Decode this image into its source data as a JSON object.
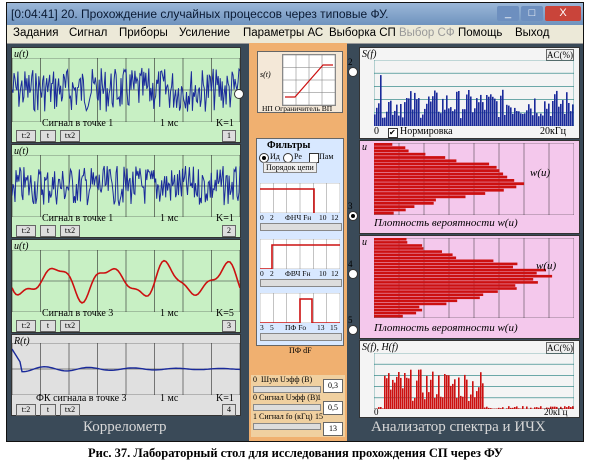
{
  "window": {
    "title": "[0:04:41] 20. Прохождение случайных процессов через типовые ФУ.",
    "buttons": {
      "minimize": "_",
      "maximize": "□",
      "close": "X"
    }
  },
  "menu": [
    "Задания",
    "Сигнал",
    "Приборы",
    "Усиление",
    "Параметры АС",
    "Выборка СП",
    "Выбор СФ",
    "Помощь",
    "Выход"
  ],
  "left": {
    "panels": [
      {
        "ylabel": "u(t)",
        "caption": "Сигнал в точке 1",
        "time": "1 мс",
        "k": "K=1",
        "num": "1"
      },
      {
        "ylabel": "u(t)",
        "caption": "Сигнал в точке 1",
        "time": "1 мс",
        "k": "K=1",
        "num": "2"
      },
      {
        "ylabel": "u(t)",
        "caption": "Сигнал в точке 3",
        "time": "1 мс",
        "k": "K=5",
        "num": "3"
      },
      {
        "ylabel": "R(t)",
        "caption": "ФК сигнала в точке 3",
        "time": "1 мс",
        "k": "K=1",
        "num": "4"
      }
    ],
    "buttons": [
      "t:2",
      "t",
      "tx2"
    ],
    "footer": "Коррелометр"
  },
  "middle": {
    "limiter": {
      "label": "НП Ограничитель ВП",
      "axis": "s(t)",
      "num": "2"
    },
    "filters": {
      "title": "Фильтры",
      "opt1": "Ид",
      "opt2": "Ре",
      "check": "Пам",
      "order": "Порядок цепи"
    },
    "f1": {
      "label": "ФНЧ Fн",
      "ticks": [
        "0",
        "2",
        "10",
        "12"
      ],
      "num": "3"
    },
    "f2": {
      "label": "ФВЧ Fн",
      "ticks": [
        "0",
        "2",
        "10",
        "12"
      ],
      "num": "4"
    },
    "f3": {
      "label": "ПФ Fо",
      "ticks": [
        "3",
        "5",
        "13",
        "15"
      ],
      "sub": "ПФ dF",
      "num": "5"
    },
    "params": [
      {
        "label": "Шум Uэфф (В)",
        "value": "0,3",
        "lo": "0"
      },
      {
        "label": "Сигнал Uэфф (В)",
        "value": "0,5",
        "lo": "0",
        "hi": "1"
      },
      {
        "label": "Сигнал fo (кГц)",
        "value": "13",
        "lo": "1",
        "hi": "15"
      }
    ]
  },
  "right": {
    "spec1": {
      "ylabel": "S(f)",
      "ac": "AC(%)",
      "x0": "0",
      "xmax": "20кГц",
      "check": "Нормировка"
    },
    "dens1": {
      "ylabel": "u",
      "wlabel": "w(u)",
      "caption": "Плотность вероятности  w(u)"
    },
    "dens2": {
      "ylabel": "u",
      "wlabel": "w(u)",
      "caption": "Плотность вероятности  w(u)"
    },
    "spec2": {
      "ylabel": "S(f), H(f)",
      "ac": "AC(%)",
      "x0": "0",
      "xmax": "20кГц"
    },
    "footer": "Анализатор спектра и ИЧХ"
  },
  "caption": "Рис. 37. Лабораторный стол для исследования прохождения СП через ФУ",
  "colors": {
    "green": "#c8f0c4",
    "pink": "#f4c8ec",
    "trace_blue": "#1a2a9a",
    "trace_red": "#cc1010",
    "orange": "#f0b070"
  }
}
